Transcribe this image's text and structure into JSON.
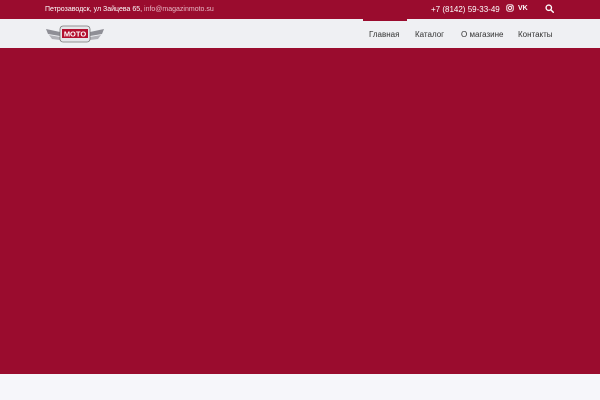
{
  "topbar": {
    "address": "Петрозаводск, ул Зайцева 65, ",
    "email": "info@magazinmoto.su",
    "phone": "+7 (8142) 59-33-49",
    "vk_label": "VK"
  },
  "nav": {
    "items": [
      {
        "label": "Главная",
        "active": true
      },
      {
        "label": "Каталог",
        "active": false
      },
      {
        "label": "О магазине",
        "active": false
      },
      {
        "label": "Контакты",
        "active": false
      }
    ]
  },
  "logo": {
    "text": "MOTO"
  },
  "colors": {
    "brand": "#9a0c2e",
    "navbar": "#eff0f3"
  },
  "icons": {
    "instagram": "instagram-icon",
    "vk": "vk-icon",
    "search": "search-icon"
  }
}
